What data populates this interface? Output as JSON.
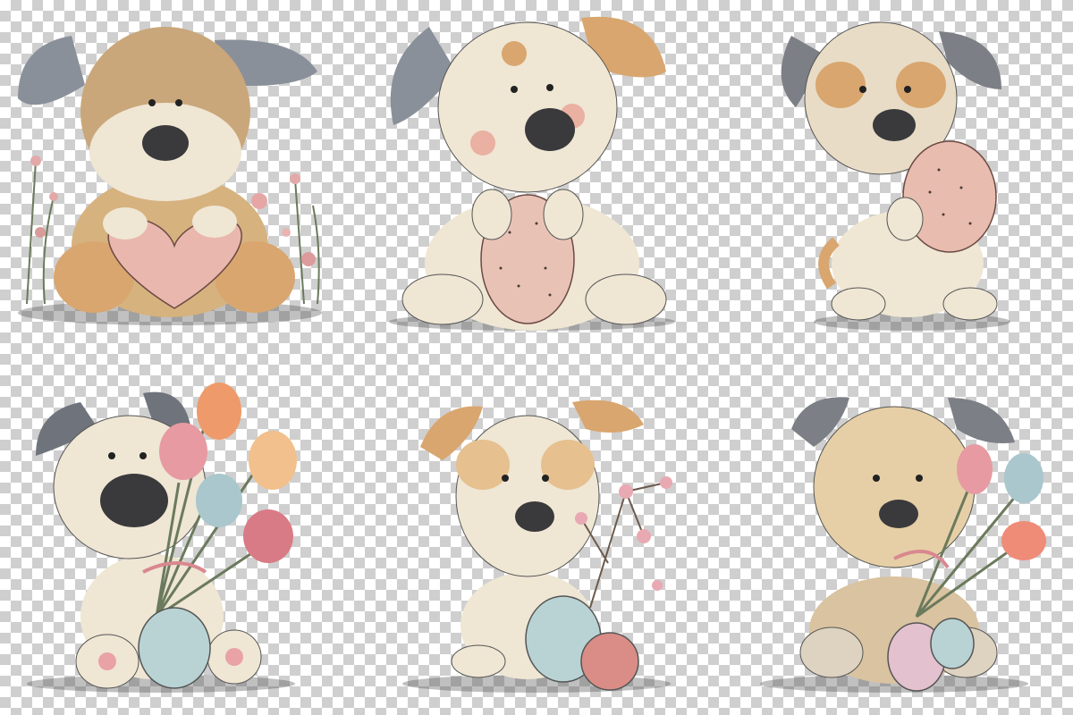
{
  "colors": {
    "fur_cream": "#efe6d4",
    "fur_tan": "#d9a66f",
    "fur_grey": "#8a9099",
    "nose": "#3a3a3c",
    "egg_pink": "#e9b7ad",
    "egg_blue": "#b9d3d4",
    "egg_rose": "#d98d86",
    "tulip_pink": "#e79aa1",
    "tulip_orange": "#ee9a6a",
    "tulip_blue": "#a9c7cc",
    "ribbon": "#d9888f",
    "checker_dark": "#cfcfcf",
    "checker_light": "#ffffff"
  },
  "illustrations": [
    {
      "subject": "puppy-with-heart",
      "prop": "heart-icon"
    },
    {
      "subject": "puppy-with-speckled-egg",
      "prop": "egg-icon"
    },
    {
      "subject": "puppy-holding-egg",
      "prop": "egg-icon"
    },
    {
      "subject": "puppy-with-tulips-and-egg",
      "prop": "tulip-icon"
    },
    {
      "subject": "puppy-with-blossoms-and-eggs",
      "prop": "blossom-icon"
    },
    {
      "subject": "puppy-with-tulips-and-eggs",
      "prop": "tulip-icon"
    }
  ]
}
